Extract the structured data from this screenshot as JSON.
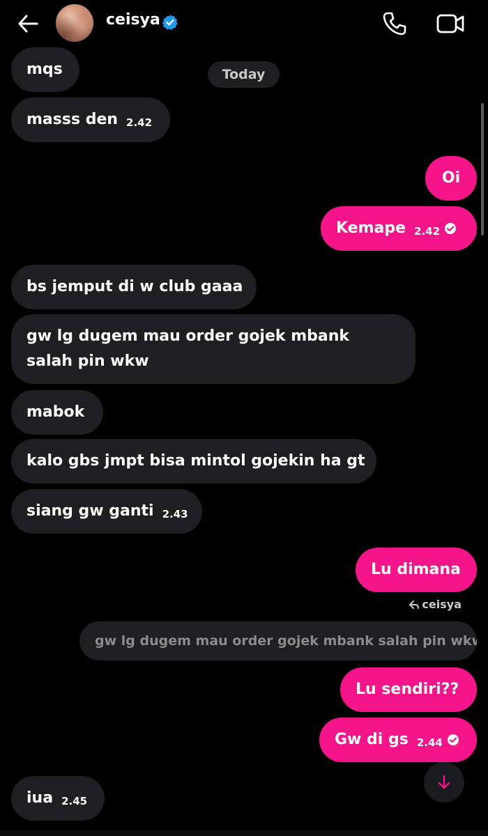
{
  "header": {
    "name": "ceisya",
    "back_icon": "arrow-left-icon",
    "verified_icon": "verified-badge-icon",
    "call_icon": "phone-icon",
    "video_icon": "video-camera-icon",
    "verified_color": "#1d9bf0"
  },
  "date_separator": "Today",
  "messages": [
    {
      "text": "mqs",
      "time": ""
    },
    {
      "text": "masss den",
      "time": "2.42"
    },
    {
      "text": "Oi",
      "time": ""
    },
    {
      "text": "Kemape",
      "time": "2.42"
    },
    {
      "text": "bs jemput di w club gaaa",
      "time": ""
    },
    {
      "text": "gw lg dugem mau order gojek mbank salah pin wkw",
      "time": ""
    },
    {
      "text": "mabok",
      "time": ""
    },
    {
      "text": "kalo gbs jmpt bisa mintol gojekin ha gt",
      "time": ""
    },
    {
      "text": "siang gw ganti",
      "time": "2.43"
    },
    {
      "text": "Lu dimana",
      "time": ""
    },
    {
      "text": "Lu sendiri??",
      "time": ""
    },
    {
      "text": "Gw di gs",
      "time": "2.44"
    },
    {
      "text": "iua",
      "time": "2.45"
    }
  ],
  "reply": {
    "label": "ceisya",
    "quoted_text": "gw lg dugem mau order gojek mbank salah pin wkw"
  },
  "colors": {
    "background": "#000000",
    "incoming_bubble": "#1e1f22",
    "outgoing_bubble": "#f5148a"
  }
}
